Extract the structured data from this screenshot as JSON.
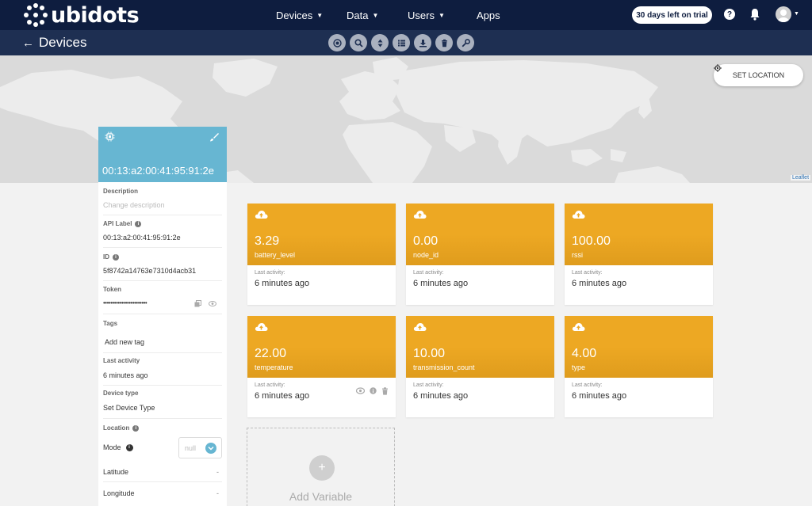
{
  "brand": {
    "name": "ubidots"
  },
  "nav": {
    "items": [
      {
        "label": "Devices",
        "has_caret": true
      },
      {
        "label": "Data",
        "has_caret": true
      },
      {
        "label": "Users",
        "has_caret": true
      },
      {
        "label": "Apps",
        "has_caret": false
      }
    ],
    "trial_label": "30 days left on trial",
    "help_label": "?"
  },
  "subbar": {
    "back_label": "Devices",
    "tools": [
      "target-icon",
      "search-icon",
      "sort-icon",
      "list-icon",
      "download-icon",
      "delete-icon",
      "key-icon"
    ]
  },
  "map": {
    "set_location_label": "SET LOCATION",
    "attribution": "Leaflet"
  },
  "device": {
    "name": "00:13:a2:00:41:95:91:2e",
    "fields": {
      "description_label": "Description",
      "description_placeholder": "Change description",
      "api_label_label": "API Label",
      "api_label_value": "00:13:a2:00:41:95:91:2e",
      "id_label": "ID",
      "id_value": "5f8742a14763e7310d4acb31",
      "token_label": "Token",
      "token_value": "••••••••••••••••••••••••",
      "tags_label": "Tags",
      "tags_placeholder": "Add new tag",
      "last_activity_label": "Last activity",
      "last_activity_value": "6 minutes ago",
      "device_type_label": "Device type",
      "device_type_value": "Set Device Type",
      "location_label": "Location",
      "mode_label": "Mode",
      "mode_value": "null",
      "latitude_label": "Latitude",
      "latitude_value": "-",
      "longitude_label": "Longitude",
      "longitude_value": "-"
    }
  },
  "variables": [
    {
      "value": "3.29",
      "name": "battery_level",
      "last_activity_label": "Last activity:",
      "time": "6 minutes ago"
    },
    {
      "value": "0.00",
      "name": "node_id",
      "last_activity_label": "Last activity:",
      "time": "6 minutes ago"
    },
    {
      "value": "100.00",
      "name": "rssi",
      "last_activity_label": "Last activity:",
      "time": "6 minutes ago"
    },
    {
      "value": "22.00",
      "name": "temperature",
      "last_activity_label": "Last activity:",
      "time": "6 minutes ago"
    },
    {
      "value": "10.00",
      "name": "transmission_count",
      "last_activity_label": "Last activity:",
      "time": "6 minutes ago"
    },
    {
      "value": "4.00",
      "name": "type",
      "last_activity_label": "Last activity:",
      "time": "6 minutes ago"
    }
  ],
  "add_variable_label": "Add Variable",
  "colors": {
    "nav_bg": "#0e1d3f",
    "subbar_bg": "#1e2f52",
    "card_accent": "#eda823",
    "device_header": "#67b6d2"
  }
}
